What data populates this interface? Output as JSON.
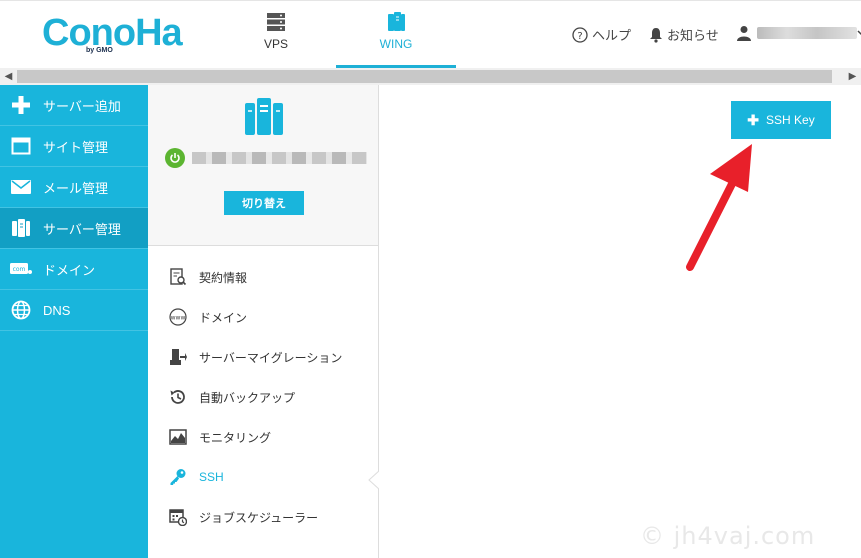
{
  "header": {
    "logo_text": "ConoHa",
    "logo_sub": "by GMO",
    "tabs": [
      {
        "label": "VPS",
        "icon": "server-rack-icon"
      },
      {
        "label": "WING",
        "icon": "wing-server-icon"
      }
    ],
    "help_label": "ヘルプ",
    "notice_label": "お知らせ"
  },
  "sidebar": {
    "items": [
      {
        "label": "サーバー追加",
        "icon": "plus-icon"
      },
      {
        "label": "サイト管理",
        "icon": "window-icon"
      },
      {
        "label": "メール管理",
        "icon": "mail-icon"
      },
      {
        "label": "サーバー管理",
        "icon": "server-icon"
      },
      {
        "label": "ドメイン",
        "icon": "domain-icon"
      },
      {
        "label": "DNS",
        "icon": "globe-icon"
      }
    ]
  },
  "server_panel": {
    "switch_label": "切り替え",
    "status_color": "#5cb531"
  },
  "menu": {
    "items": [
      {
        "label": "契約情報",
        "icon": "contract-icon"
      },
      {
        "label": "ドメイン",
        "icon": "www-icon"
      },
      {
        "label": "サーバーマイグレーション",
        "icon": "migration-icon"
      },
      {
        "label": "自動バックアップ",
        "icon": "backup-icon"
      },
      {
        "label": "モニタリング",
        "icon": "monitoring-icon"
      },
      {
        "label": "SSH",
        "icon": "key-icon"
      },
      {
        "label": "ジョブスケジューラー",
        "icon": "scheduler-icon"
      }
    ]
  },
  "content": {
    "ssh_key_button": "SSH Key"
  },
  "watermark": "© jh4vaj.com",
  "colors": {
    "accent": "#19b5dc",
    "accent_dark": "#129fc4",
    "annotation_arrow": "#e8202a"
  }
}
